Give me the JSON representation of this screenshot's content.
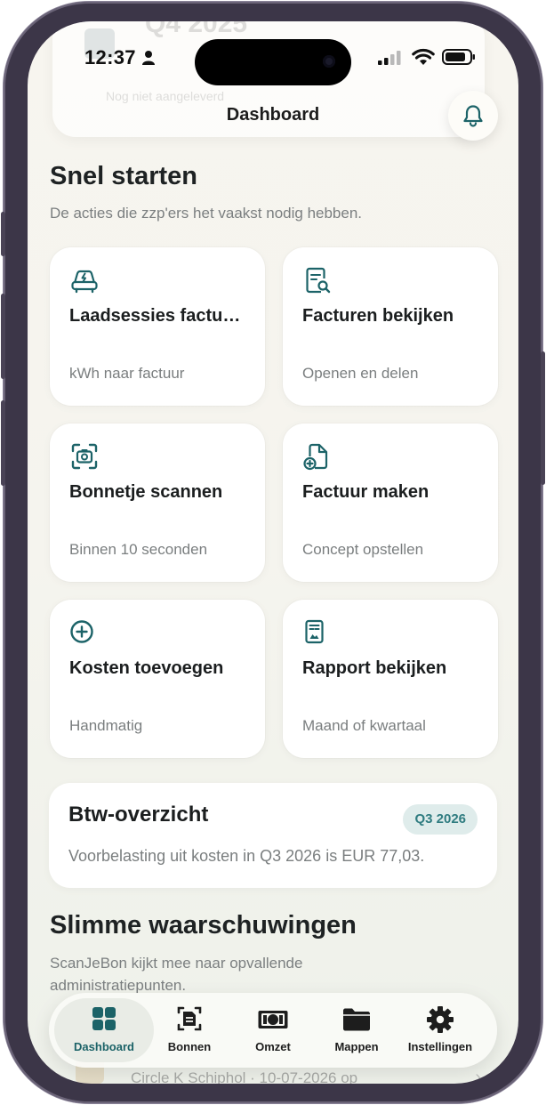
{
  "status_bar": {
    "time": "12:37"
  },
  "ghost_card": {
    "title": "Q4 2025",
    "subtitle": "Nog niet aangeleverd"
  },
  "nav": {
    "title": "Dashboard"
  },
  "quick_start": {
    "title": "Snel starten",
    "subtitle": "De acties die zzp'ers het vaakst nodig hebben.",
    "tiles": [
      {
        "icon": "ev-car-icon",
        "title": "Laadsessies factuur maken",
        "subtitle": "kWh naar factuur"
      },
      {
        "icon": "invoice-search-icon",
        "title": "Facturen bekijken",
        "subtitle": "Openen en delen"
      },
      {
        "icon": "scan-camera-icon",
        "title": "Bonnetje scannen",
        "subtitle": "Binnen 10 seconden"
      },
      {
        "icon": "new-document-icon",
        "title": "Factuur maken",
        "subtitle": "Concept opstellen"
      },
      {
        "icon": "plus-circle-icon",
        "title": "Kosten toevoegen",
        "subtitle": "Handmatig"
      },
      {
        "icon": "report-icon",
        "title": "Rapport bekijken",
        "subtitle": "Maand of kwartaal"
      }
    ]
  },
  "vat": {
    "title": "Btw-overzicht",
    "badge": "Q3 2026",
    "text": "Voorbelasting uit kosten in Q3 2026 is EUR 77,03."
  },
  "warnings": {
    "title": "Slimme waarschuwingen",
    "subtitle_line1": "ScanJeBon kijkt mee naar opvallende",
    "subtitle_line2": "administratiepunten.",
    "behind_text": "Circle K Schiphol · 10-07-2026 op"
  },
  "tabbar": {
    "tabs": [
      {
        "label": "Dashboard",
        "icon": "dashboard-grid-icon",
        "active": true
      },
      {
        "label": "Bonnen",
        "icon": "receipt-scan-icon",
        "active": false
      },
      {
        "label": "Omzet",
        "icon": "banknote-icon",
        "active": false
      },
      {
        "label": "Mappen",
        "icon": "folder-icon",
        "active": false
      },
      {
        "label": "Instellingen",
        "icon": "gear-icon",
        "active": false
      }
    ]
  },
  "colors": {
    "accent": "#1c6368",
    "badge_bg": "#dfeceb",
    "badge_text": "#2f7c80",
    "background": "#f6f4ee"
  }
}
